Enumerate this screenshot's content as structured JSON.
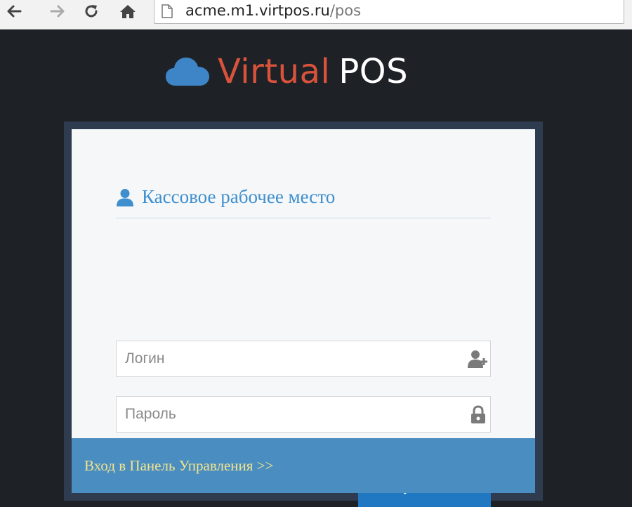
{
  "browser": {
    "url_host": "acme.m1.virtpos.ru",
    "url_path": "/pos",
    "back_icon": "arrow-left-icon",
    "forward_icon": "arrow-right-icon",
    "reload_icon": "reload-icon",
    "home_icon": "home-icon",
    "page_icon": "page-icon"
  },
  "logo": {
    "word1": "Virtual",
    "word2": "POS",
    "icon": "cloud-icon",
    "colors": {
      "cloud": "#3d85c6",
      "word1": "#d9533c",
      "word2": "#ffffff"
    }
  },
  "login_form": {
    "title": "Кассовое рабочее место",
    "title_icon": "user-icon",
    "login_placeholder": "Логин",
    "login_icon": "user-add-icon",
    "password_placeholder": "Пароль",
    "password_icon": "lock-icon",
    "submit_label": "Войти",
    "submit_icon": "key-icon"
  },
  "footer": {
    "admin_link": "Вход в Панель Управления >>"
  },
  "colors": {
    "page_bg": "#1e2126",
    "panel_border": "#2f3c4f",
    "card_bg": "#f6f7f8",
    "accent": "#1f78c1",
    "title": "#3f8fcf",
    "footer_bar": "#4a8ec1",
    "footer_link": "#f3e38d"
  }
}
